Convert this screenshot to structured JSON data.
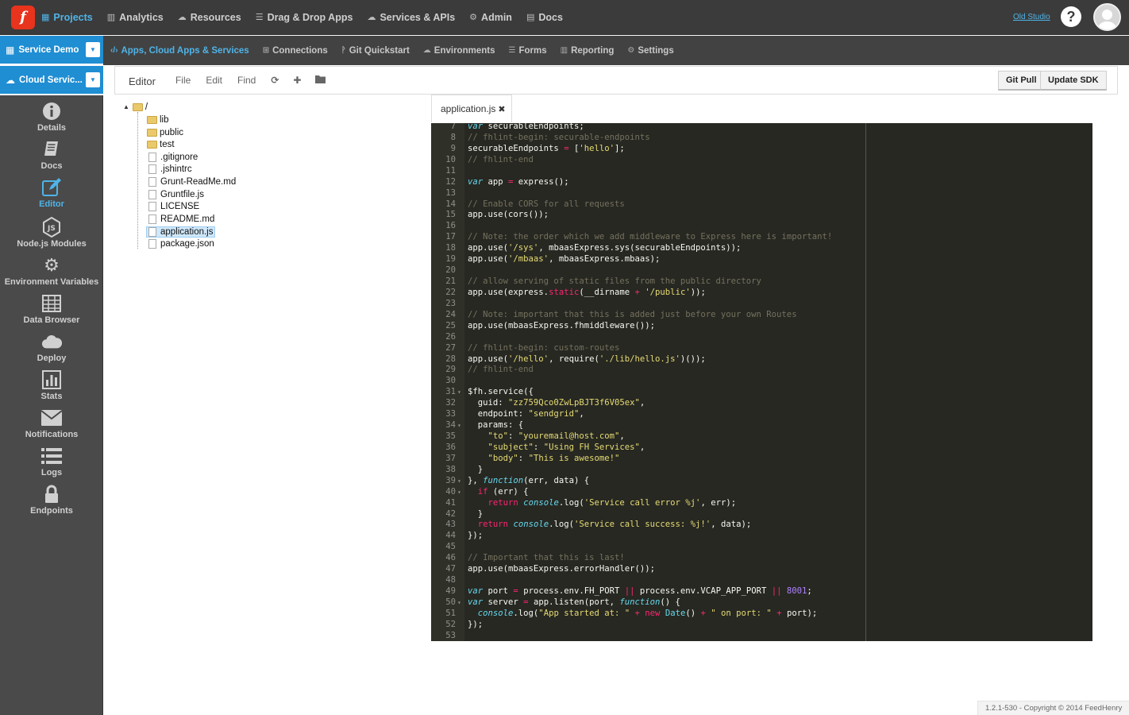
{
  "topnav": {
    "logo": "f",
    "items": [
      {
        "label": "Projects",
        "icon": "grid-icon"
      },
      {
        "label": "Analytics",
        "icon": "chart-icon"
      },
      {
        "label": "Resources",
        "icon": "cloud-icon"
      },
      {
        "label": "Drag & Drop Apps",
        "icon": "list-icon"
      },
      {
        "label": "Services & APIs",
        "icon": "cloud-gear-icon"
      },
      {
        "label": "Admin",
        "icon": "gears-icon"
      },
      {
        "label": "Docs",
        "icon": "book-icon"
      }
    ],
    "old_studio": "Old Studio",
    "help": "?"
  },
  "project": {
    "name": "Service Demo",
    "app": "Cloud Servic..."
  },
  "subnav": {
    "items": [
      {
        "label": "Apps, Cloud Apps & Services",
        "icon": "code-icon"
      },
      {
        "label": "Connections",
        "icon": "sitemap-icon"
      },
      {
        "label": "Git Quickstart",
        "icon": "git-icon"
      },
      {
        "label": "Environments",
        "icon": "cloud-icon"
      },
      {
        "label": "Forms",
        "icon": "list-icon"
      },
      {
        "label": "Reporting",
        "icon": "chart-icon"
      },
      {
        "label": "Settings",
        "icon": "gears-icon"
      }
    ]
  },
  "sidebar": {
    "items": [
      {
        "label": "Details",
        "icon": "info-icon"
      },
      {
        "label": "Docs",
        "icon": "book-icon"
      },
      {
        "label": "Editor",
        "icon": "edit-icon"
      },
      {
        "label": "Node.js Modules",
        "icon": "nodejs-icon"
      },
      {
        "label": "Environment Variables",
        "icon": "gears-icon"
      },
      {
        "label": "Data Browser",
        "icon": "table-icon"
      },
      {
        "label": "Deploy",
        "icon": "cloud-icon"
      },
      {
        "label": "Stats",
        "icon": "bar-chart-icon"
      },
      {
        "label": "Notifications",
        "icon": "envelope-icon"
      },
      {
        "label": "Logs",
        "icon": "list-icon"
      },
      {
        "label": "Endpoints",
        "icon": "lock-icon"
      }
    ]
  },
  "editor": {
    "title": "Editor",
    "menus": [
      "File",
      "Edit",
      "Find"
    ],
    "git_pull": "Git Pull",
    "update_sdk": "Update SDK",
    "tab": "application.js",
    "tab_close": "✖"
  },
  "tree": {
    "root": "/",
    "folders": [
      "lib",
      "public",
      "test"
    ],
    "files": [
      ".gitignore",
      ".jshintrc",
      "Grunt-ReadMe.md",
      "Gruntfile.js",
      "LICENSE",
      "README.md",
      "application.js",
      "package.json"
    ]
  },
  "code": {
    "lines": [
      {
        "n": "7",
        "text": "var securableEndpoints;"
      },
      {
        "n": "8",
        "text": "// fhlint-begin: securable-endpoints"
      },
      {
        "n": "9",
        "text": "securableEndpoints = ['hello'];"
      },
      {
        "n": "10",
        "text": "// fhlint-end"
      },
      {
        "n": "11",
        "text": ""
      },
      {
        "n": "12",
        "text": "var app = express();"
      },
      {
        "n": "13",
        "text": ""
      },
      {
        "n": "14",
        "text": "// Enable CORS for all requests"
      },
      {
        "n": "15",
        "text": "app.use(cors());"
      },
      {
        "n": "16",
        "text": ""
      },
      {
        "n": "17",
        "text": "// Note: the order which we add middleware to Express here is important!"
      },
      {
        "n": "18",
        "text": "app.use('/sys', mbaasExpress.sys(securableEndpoints));"
      },
      {
        "n": "19",
        "text": "app.use('/mbaas', mbaasExpress.mbaas);"
      },
      {
        "n": "20",
        "text": ""
      },
      {
        "n": "21",
        "text": "// allow serving of static files from the public directory"
      },
      {
        "n": "22",
        "text": "app.use(express.static(__dirname + '/public'));"
      },
      {
        "n": "23",
        "text": ""
      },
      {
        "n": "24",
        "text": "// Note: important that this is added just before your own Routes"
      },
      {
        "n": "25",
        "text": "app.use(mbaasExpress.fhmiddleware());"
      },
      {
        "n": "26",
        "text": ""
      },
      {
        "n": "27",
        "text": "// fhlint-begin: custom-routes"
      },
      {
        "n": "28",
        "text": "app.use('/hello', require('./lib/hello.js')());"
      },
      {
        "n": "29",
        "text": "// fhlint-end"
      },
      {
        "n": "30",
        "text": ""
      },
      {
        "n": "31",
        "text": "$fh.service({"
      },
      {
        "n": "32",
        "text": "  guid: \"zz759Qco0ZwLpBJT3f6V05ex\","
      },
      {
        "n": "33",
        "text": "  endpoint: \"sendgrid\","
      },
      {
        "n": "34",
        "text": "  params: {"
      },
      {
        "n": "35",
        "text": "    \"to\": \"youremail@host.com\","
      },
      {
        "n": "36",
        "text": "    \"subject\": \"Using FH Services\","
      },
      {
        "n": "37",
        "text": "    \"body\": \"This is awesome!\""
      },
      {
        "n": "38",
        "text": "  }"
      },
      {
        "n": "39",
        "text": "}, function(err, data) {"
      },
      {
        "n": "40",
        "text": "  if (err) {"
      },
      {
        "n": "41",
        "text": "    return console.log('Service call error %j', err);"
      },
      {
        "n": "42",
        "text": "  }"
      },
      {
        "n": "43",
        "text": "  return console.log('Service call success: %j!', data);"
      },
      {
        "n": "44",
        "text": "});"
      },
      {
        "n": "45",
        "text": ""
      },
      {
        "n": "46",
        "text": "// Important that this is last!"
      },
      {
        "n": "47",
        "text": "app.use(mbaasExpress.errorHandler());"
      },
      {
        "n": "48",
        "text": ""
      },
      {
        "n": "49",
        "text": "var port = process.env.FH_PORT || process.env.VCAP_APP_PORT || 8001;"
      },
      {
        "n": "50",
        "text": "var server = app.listen(port, function() {"
      },
      {
        "n": "51",
        "text": "  console.log(\"App started at: \" + new Date() + \" on port: \" + port);"
      },
      {
        "n": "52",
        "text": "});"
      },
      {
        "n": "53",
        "text": ""
      }
    ],
    "fold_lines": [
      "31",
      "34",
      "39",
      "40",
      "50"
    ]
  },
  "footer": "1.2.1-530 - Copyright © 2014 FeedHenry",
  "colors": {
    "accent": "#4fb4e8",
    "project_blue": "#1f8ed3",
    "editor_bg": "#272822",
    "topbar": "#3b3b3b"
  }
}
